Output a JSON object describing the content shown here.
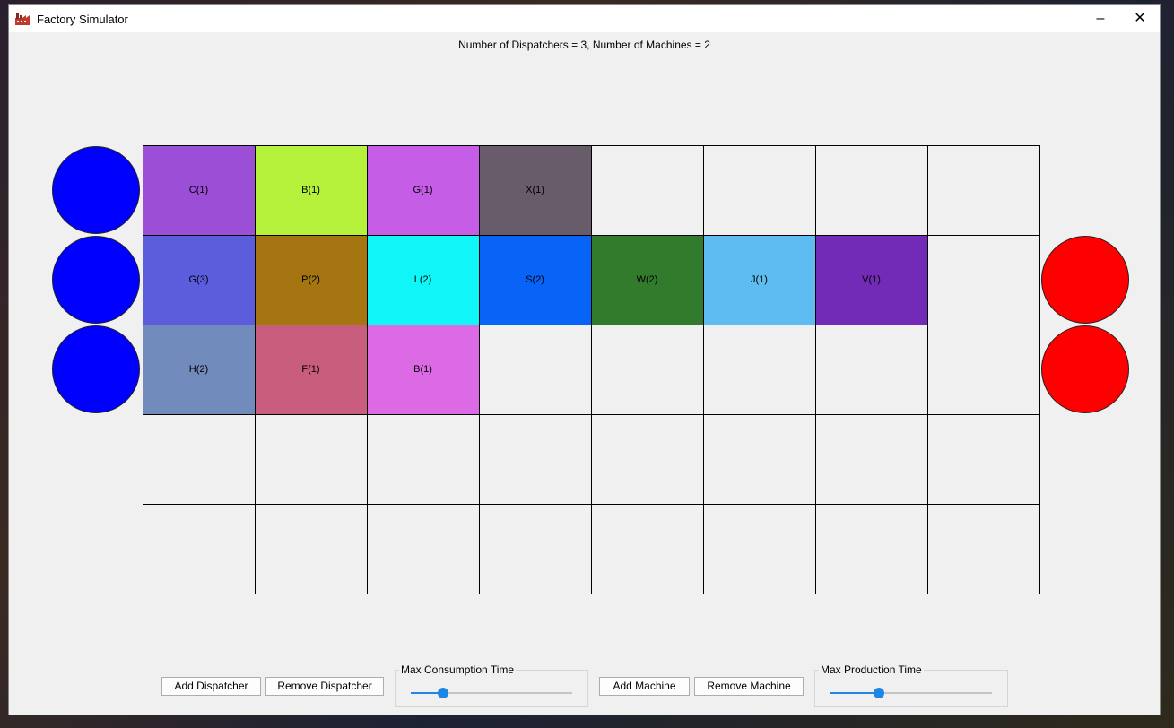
{
  "window": {
    "title": "Factory Simulator",
    "minimize_glyph": "–",
    "close_glyph": "✕"
  },
  "status_text": "Number of Dispatchers = 3, Number of Machines = 2",
  "dispatchers": {
    "count": 3,
    "color": "#0000ff"
  },
  "machines": {
    "count": 2,
    "color": "#ff0000"
  },
  "grid": {
    "cols": 8,
    "rows": 5,
    "cells": [
      {
        "row": 0,
        "col": 0,
        "label": "C(1)",
        "color": "#9b4fd6"
      },
      {
        "row": 0,
        "col": 1,
        "label": "B(1)",
        "color": "#b6f23c"
      },
      {
        "row": 0,
        "col": 2,
        "label": "G(1)",
        "color": "#c55de6"
      },
      {
        "row": 0,
        "col": 3,
        "label": "X(1)",
        "color": "#685c6a"
      },
      {
        "row": 1,
        "col": 0,
        "label": "G(3)",
        "color": "#5b5ddd"
      },
      {
        "row": 1,
        "col": 1,
        "label": "P(2)",
        "color": "#a57511"
      },
      {
        "row": 1,
        "col": 2,
        "label": "L(2)",
        "color": "#10f5f8"
      },
      {
        "row": 1,
        "col": 3,
        "label": "S(2)",
        "color": "#0864f7"
      },
      {
        "row": 1,
        "col": 4,
        "label": "W(2)",
        "color": "#327b2c"
      },
      {
        "row": 1,
        "col": 5,
        "label": "J(1)",
        "color": "#5fbcf0"
      },
      {
        "row": 1,
        "col": 6,
        "label": "V(1)",
        "color": "#712bb6"
      },
      {
        "row": 2,
        "col": 0,
        "label": "H(2)",
        "color": "#718bbd"
      },
      {
        "row": 2,
        "col": 1,
        "label": "F(1)",
        "color": "#c85d7d"
      },
      {
        "row": 2,
        "col": 2,
        "label": "B(1)",
        "color": "#dc6ae5"
      }
    ]
  },
  "controls": {
    "add_dispatcher": "Add Dispatcher",
    "remove_dispatcher": "Remove Dispatcher",
    "max_consumption_title": "Max Consumption Time",
    "max_consumption_value": 0.2,
    "add_machine": "Add Machine",
    "remove_machine": "Remove Machine",
    "max_production_title": "Max Production Time",
    "max_production_value": 0.3
  },
  "accent_color": "#1e87e5"
}
